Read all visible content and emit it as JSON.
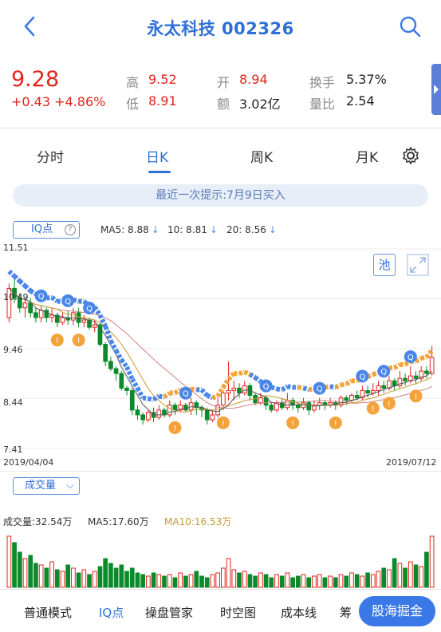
{
  "header": {
    "title": "永太科技 002326"
  },
  "quote": {
    "price": "9.28",
    "change": "+0.43 +4.86%",
    "high_label": "高",
    "high": "9.52",
    "low_label": "低",
    "low": "8.91",
    "open_label": "开",
    "open": "8.94",
    "amount_label": "额",
    "amount": "3.02亿",
    "turnover_label": "换手",
    "turnover": "5.37%",
    "vol_ratio_label": "量比",
    "vol_ratio": "2.54"
  },
  "tabs": [
    {
      "label": "分时",
      "active": false
    },
    {
      "label": "日K",
      "active": true
    },
    {
      "label": "周K",
      "active": false
    },
    {
      "label": "月K",
      "active": false
    }
  ],
  "hint": "最近一次提示:7月9日买入",
  "indicator_bar": {
    "iq_label": "IQ点",
    "help": "?",
    "ma5": "MA5: 8.88",
    "ma10": "10: 8.81",
    "ma20": "20: 8.56"
  },
  "pool_label": "池",
  "chart_data": {
    "type": "candlestick",
    "y_ticks": [
      "11.51",
      "10.49",
      "9.46",
      "8.44",
      "7.41"
    ],
    "y_range": [
      7.41,
      11.51
    ],
    "x_start": "2019/04/04",
    "x_end": "2019/07/12",
    "colors": {
      "up": "#e2231a",
      "down": "#0a8a2a",
      "ma5": "#555555",
      "ma10": "#c79a2f",
      "ma20": "#d08080",
      "iq_up": "#f3a33a",
      "iq_down": "#4a86e8"
    },
    "candles": [
      [
        10.1,
        10.7,
        10.0,
        10.8
      ],
      [
        10.7,
        10.5,
        10.4,
        10.9
      ],
      [
        10.5,
        10.3,
        10.2,
        10.6
      ],
      [
        10.3,
        10.4,
        10.1,
        10.5
      ],
      [
        10.4,
        10.2,
        10.1,
        10.5
      ],
      [
        10.2,
        10.1,
        10.0,
        10.3
      ],
      [
        10.1,
        10.25,
        10.0,
        10.35
      ],
      [
        10.25,
        10.1,
        10.0,
        10.3
      ],
      [
        10.1,
        10.15,
        10.0,
        10.3
      ],
      [
        10.15,
        10.0,
        9.9,
        10.2
      ],
      [
        10.0,
        10.1,
        9.95,
        10.2
      ],
      [
        10.1,
        10.05,
        9.95,
        10.25
      ],
      [
        10.05,
        10.2,
        9.95,
        10.3
      ],
      [
        10.2,
        10.0,
        9.9,
        10.3
      ],
      [
        10.0,
        10.05,
        9.9,
        10.15
      ],
      [
        10.05,
        9.9,
        9.85,
        10.1
      ],
      [
        9.9,
        9.95,
        9.8,
        10.05
      ],
      [
        9.95,
        9.55,
        9.5,
        10.0
      ],
      [
        9.55,
        9.2,
        9.1,
        9.6
      ],
      [
        9.2,
        9.05,
        9.0,
        9.3
      ],
      [
        9.05,
        8.95,
        8.8,
        9.1
      ],
      [
        8.95,
        8.65,
        8.6,
        9.0
      ],
      [
        8.65,
        8.6,
        8.5,
        8.7
      ],
      [
        8.6,
        8.2,
        8.1,
        8.65
      ],
      [
        8.2,
        8.1,
        8.0,
        8.3
      ],
      [
        8.1,
        8.0,
        7.9,
        8.15
      ],
      [
        8.0,
        8.15,
        7.95,
        8.2
      ],
      [
        8.15,
        8.05,
        7.95,
        8.25
      ],
      [
        8.05,
        8.2,
        8.0,
        8.3
      ],
      [
        8.2,
        8.1,
        8.05,
        8.25
      ],
      [
        8.1,
        8.3,
        8.05,
        8.4
      ],
      [
        8.3,
        8.2,
        8.1,
        8.35
      ],
      [
        8.2,
        8.3,
        8.15,
        8.4
      ],
      [
        8.3,
        8.2,
        8.15,
        8.35
      ],
      [
        8.2,
        8.35,
        8.1,
        8.45
      ],
      [
        8.35,
        8.25,
        8.1,
        8.4
      ],
      [
        8.25,
        8.2,
        8.05,
        8.3
      ],
      [
        8.2,
        8.0,
        7.9,
        8.25
      ],
      [
        8.0,
        8.1,
        7.95,
        8.2
      ],
      [
        8.1,
        8.3,
        8.05,
        8.45
      ],
      [
        8.3,
        8.55,
        8.2,
        8.6
      ],
      [
        8.55,
        8.6,
        8.4,
        9.2
      ],
      [
        8.6,
        8.65,
        8.4,
        8.8
      ],
      [
        8.65,
        8.55,
        8.45,
        8.75
      ],
      [
        8.55,
        8.7,
        8.5,
        8.8
      ],
      [
        8.7,
        8.5,
        8.4,
        8.75
      ],
      [
        8.5,
        8.35,
        8.3,
        8.55
      ],
      [
        8.35,
        8.45,
        8.3,
        8.55
      ],
      [
        8.45,
        8.3,
        8.2,
        8.5
      ],
      [
        8.3,
        8.2,
        8.15,
        8.35
      ],
      [
        8.2,
        8.35,
        8.15,
        8.4
      ],
      [
        8.35,
        8.25,
        8.2,
        8.45
      ],
      [
        8.25,
        8.4,
        8.2,
        8.55
      ],
      [
        8.4,
        8.3,
        8.2,
        8.45
      ],
      [
        8.3,
        8.25,
        8.15,
        8.35
      ],
      [
        8.25,
        8.35,
        8.2,
        8.45
      ],
      [
        8.35,
        8.2,
        8.1,
        8.4
      ],
      [
        8.2,
        8.3,
        8.15,
        8.4
      ],
      [
        8.3,
        8.35,
        8.2,
        8.45
      ],
      [
        8.35,
        8.3,
        8.2,
        8.4
      ],
      [
        8.3,
        8.35,
        8.25,
        8.45
      ],
      [
        8.35,
        8.3,
        8.2,
        8.4
      ],
      [
        8.3,
        8.45,
        8.25,
        8.5
      ],
      [
        8.45,
        8.4,
        8.3,
        8.5
      ],
      [
        8.4,
        8.5,
        8.35,
        8.55
      ],
      [
        8.5,
        8.45,
        8.4,
        8.6
      ],
      [
        8.45,
        8.6,
        8.4,
        8.7
      ],
      [
        8.6,
        8.55,
        8.45,
        8.7
      ],
      [
        8.55,
        8.6,
        8.5,
        8.75
      ],
      [
        8.6,
        8.7,
        8.5,
        8.8
      ],
      [
        8.7,
        8.65,
        8.55,
        8.8
      ],
      [
        8.65,
        8.8,
        8.6,
        8.9
      ],
      [
        8.8,
        8.7,
        8.6,
        8.85
      ],
      [
        8.7,
        8.85,
        8.65,
        9.0
      ],
      [
        8.85,
        8.8,
        8.7,
        8.95
      ],
      [
        8.8,
        8.9,
        8.75,
        9.1
      ],
      [
        8.9,
        8.85,
        8.75,
        9.0
      ],
      [
        8.85,
        9.0,
        8.8,
        9.1
      ],
      [
        9.0,
        8.95,
        8.85,
        9.1
      ],
      [
        8.95,
        9.28,
        8.91,
        9.52
      ]
    ],
    "volume": {
      "label": "成交量:32.54万",
      "ma5": "MA5:17.60万",
      "ma10": "MA10:16.53万",
      "bars": [
        32,
        28,
        22,
        18,
        20,
        15,
        14,
        12,
        16,
        11,
        10,
        14,
        12,
        9,
        11,
        8,
        10,
        13,
        18,
        15,
        12,
        14,
        10,
        12,
        9,
        8,
        7,
        9,
        8,
        7,
        8,
        6,
        9,
        7,
        8,
        10,
        7,
        6,
        8,
        9,
        12,
        18,
        11,
        9,
        10,
        8,
        7,
        9,
        8,
        6,
        8,
        7,
        9,
        6,
        7,
        8,
        6,
        7,
        8,
        6,
        7,
        6,
        8,
        7,
        9,
        8,
        7,
        9,
        8,
        10,
        12,
        11,
        18,
        15,
        12,
        16,
        14,
        13,
        22,
        32
      ]
    }
  },
  "volume_chip": "成交量",
  "toolbar": {
    "items": [
      "普通模式",
      "IQ点",
      "操盘管家",
      "时空图",
      "成本线",
      "筹"
    ],
    "cta": "股海掘金"
  }
}
